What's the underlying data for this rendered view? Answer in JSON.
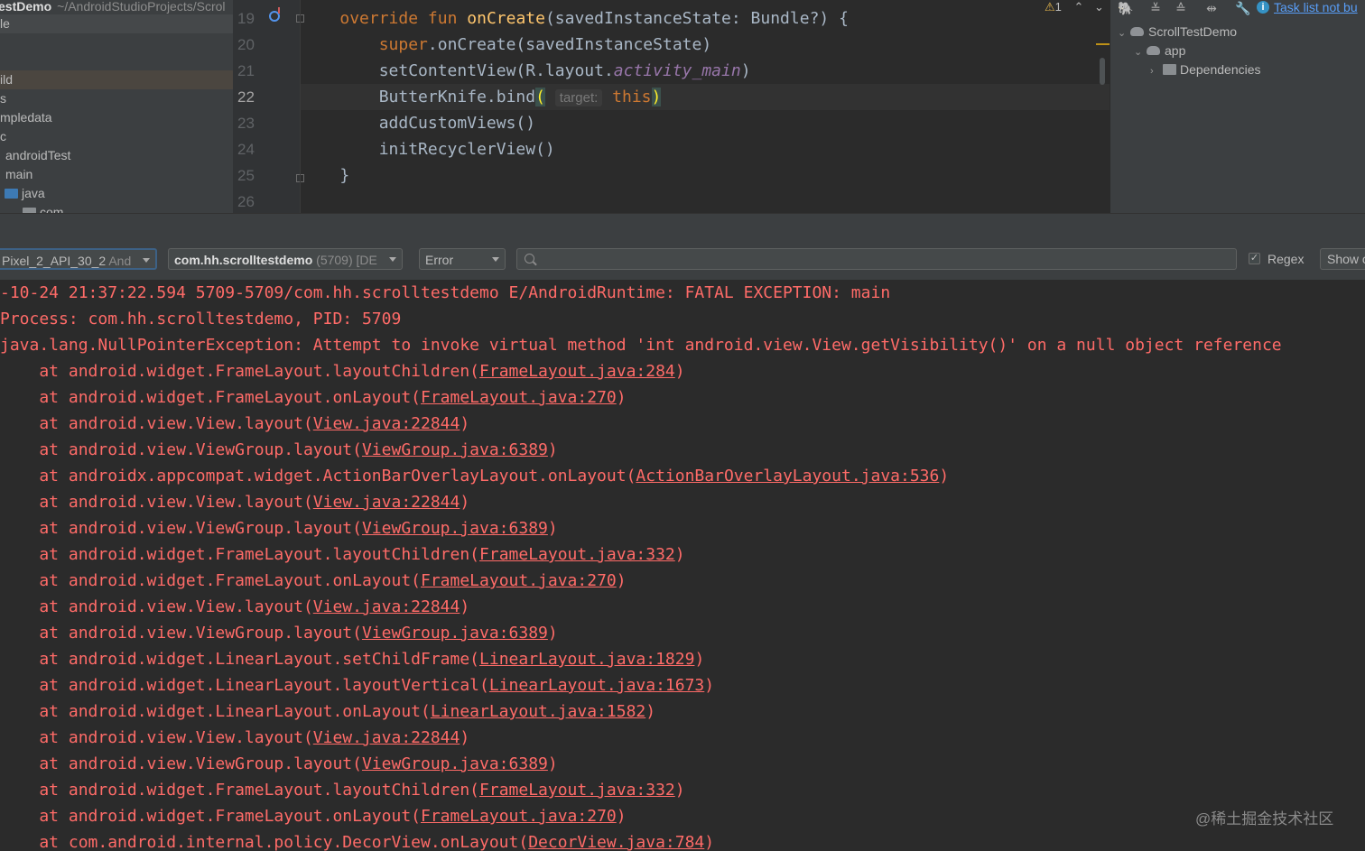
{
  "project": {
    "name": "estDemo",
    "path": "~/AndroidStudioProjects/Scrol",
    "items": [
      "le",
      "",
      "ild",
      "s",
      "mpledata",
      "c",
      "androidTest",
      "main",
      "java",
      "com"
    ]
  },
  "editor": {
    "line_numbers": [
      "19",
      "20",
      "21",
      "22",
      "23",
      "24",
      "25",
      "26"
    ],
    "warnings_count": "1",
    "lines": [
      {
        "indent": "    ",
        "kw1": "override",
        "kw2": "fun",
        "fn": "onCreate",
        "rest": "(savedInstanceState: Bundle?) {"
      },
      {
        "indent": "        ",
        "kw": "super",
        "rest": ".onCreate(savedInstanceState)"
      },
      {
        "indent": "        ",
        "pre": "setContentView(R.layout.",
        "it": "activity_main",
        "rest": ")"
      },
      {
        "indent": "        ",
        "pre": "ButterKnife.bind",
        "open": "(",
        "hint": "target:",
        "kw": "this",
        "close": ")"
      },
      {
        "indent": "        ",
        "pre": "addCustomViews()"
      },
      {
        "indent": "        ",
        "pre": "initRecyclerView()"
      },
      {
        "indent": "    ",
        "pre": "}"
      },
      {
        "indent": "",
        "pre": ""
      }
    ]
  },
  "gradle_panel": {
    "task_link": "Task list not bu",
    "tree": [
      "ScrollTestDemo",
      "app",
      "Dependencies"
    ]
  },
  "logcat": {
    "device": "Pixel_2_API_30_2",
    "device_suffix": "And",
    "process_bold": "com.hh.scrolltestdemo",
    "process_pid": "(5709)",
    "process_suffix": "[DE",
    "level": "Error",
    "search_placeholder": "",
    "regex_label": "Regex",
    "regex_checked": true,
    "show_label": "Show o"
  },
  "log_lines": [
    {
      "text": "-10-24 21:37:22.594 5709-5709/com.hh.scrolltestdemo E/AndroidRuntime: FATAL EXCEPTION: main"
    },
    {
      "text": "Process: com.hh.scrolltestdemo, PID: 5709"
    },
    {
      "text": "java.lang.NullPointerException: Attempt to invoke virtual method 'int android.view.View.getVisibility()' on a null object reference"
    },
    {
      "pre": "    at android.widget.FrameLayout.layoutChildren(",
      "link": "FrameLayout.java:284",
      "post": ")"
    },
    {
      "pre": "    at android.widget.FrameLayout.onLayout(",
      "link": "FrameLayout.java:270",
      "post": ")"
    },
    {
      "pre": "    at android.view.View.layout(",
      "link": "View.java:22844",
      "post": ")"
    },
    {
      "pre": "    at android.view.ViewGroup.layout(",
      "link": "ViewGroup.java:6389",
      "post": ")"
    },
    {
      "pre": "    at androidx.appcompat.widget.ActionBarOverlayLayout.onLayout(",
      "link": "ActionBarOverlayLayout.java:536",
      "post": ")"
    },
    {
      "pre": "    at android.view.View.layout(",
      "link": "View.java:22844",
      "post": ")"
    },
    {
      "pre": "    at android.view.ViewGroup.layout(",
      "link": "ViewGroup.java:6389",
      "post": ")"
    },
    {
      "pre": "    at android.widget.FrameLayout.layoutChildren(",
      "link": "FrameLayout.java:332",
      "post": ")"
    },
    {
      "pre": "    at android.widget.FrameLayout.onLayout(",
      "link": "FrameLayout.java:270",
      "post": ")"
    },
    {
      "pre": "    at android.view.View.layout(",
      "link": "View.java:22844",
      "post": ")"
    },
    {
      "pre": "    at android.view.ViewGroup.layout(",
      "link": "ViewGroup.java:6389",
      "post": ")"
    },
    {
      "pre": "    at android.widget.LinearLayout.setChildFrame(",
      "link": "LinearLayout.java:1829",
      "post": ")"
    },
    {
      "pre": "    at android.widget.LinearLayout.layoutVertical(",
      "link": "LinearLayout.java:1673",
      "post": ")"
    },
    {
      "pre": "    at android.widget.LinearLayout.onLayout(",
      "link": "LinearLayout.java:1582",
      "post": ")"
    },
    {
      "pre": "    at android.view.View.layout(",
      "link": "View.java:22844",
      "post": ")"
    },
    {
      "pre": "    at android.view.ViewGroup.layout(",
      "link": "ViewGroup.java:6389",
      "post": ")"
    },
    {
      "pre": "    at android.widget.FrameLayout.layoutChildren(",
      "link": "FrameLayout.java:332",
      "post": ")"
    },
    {
      "pre": "    at android.widget.FrameLayout.onLayout(",
      "link": "FrameLayout.java:270",
      "post": ")"
    },
    {
      "pre": "    at com.android.internal.policy.DecorView.onLayout(",
      "link": "DecorView.java:784",
      "post": ")"
    }
  ],
  "watermark": "@稀土掘金技术社区",
  "colors": {
    "error_red": "#ff6b68",
    "keyword": "#cc7832",
    "function": "#ffc66d",
    "link_blue": "#589df6"
  }
}
